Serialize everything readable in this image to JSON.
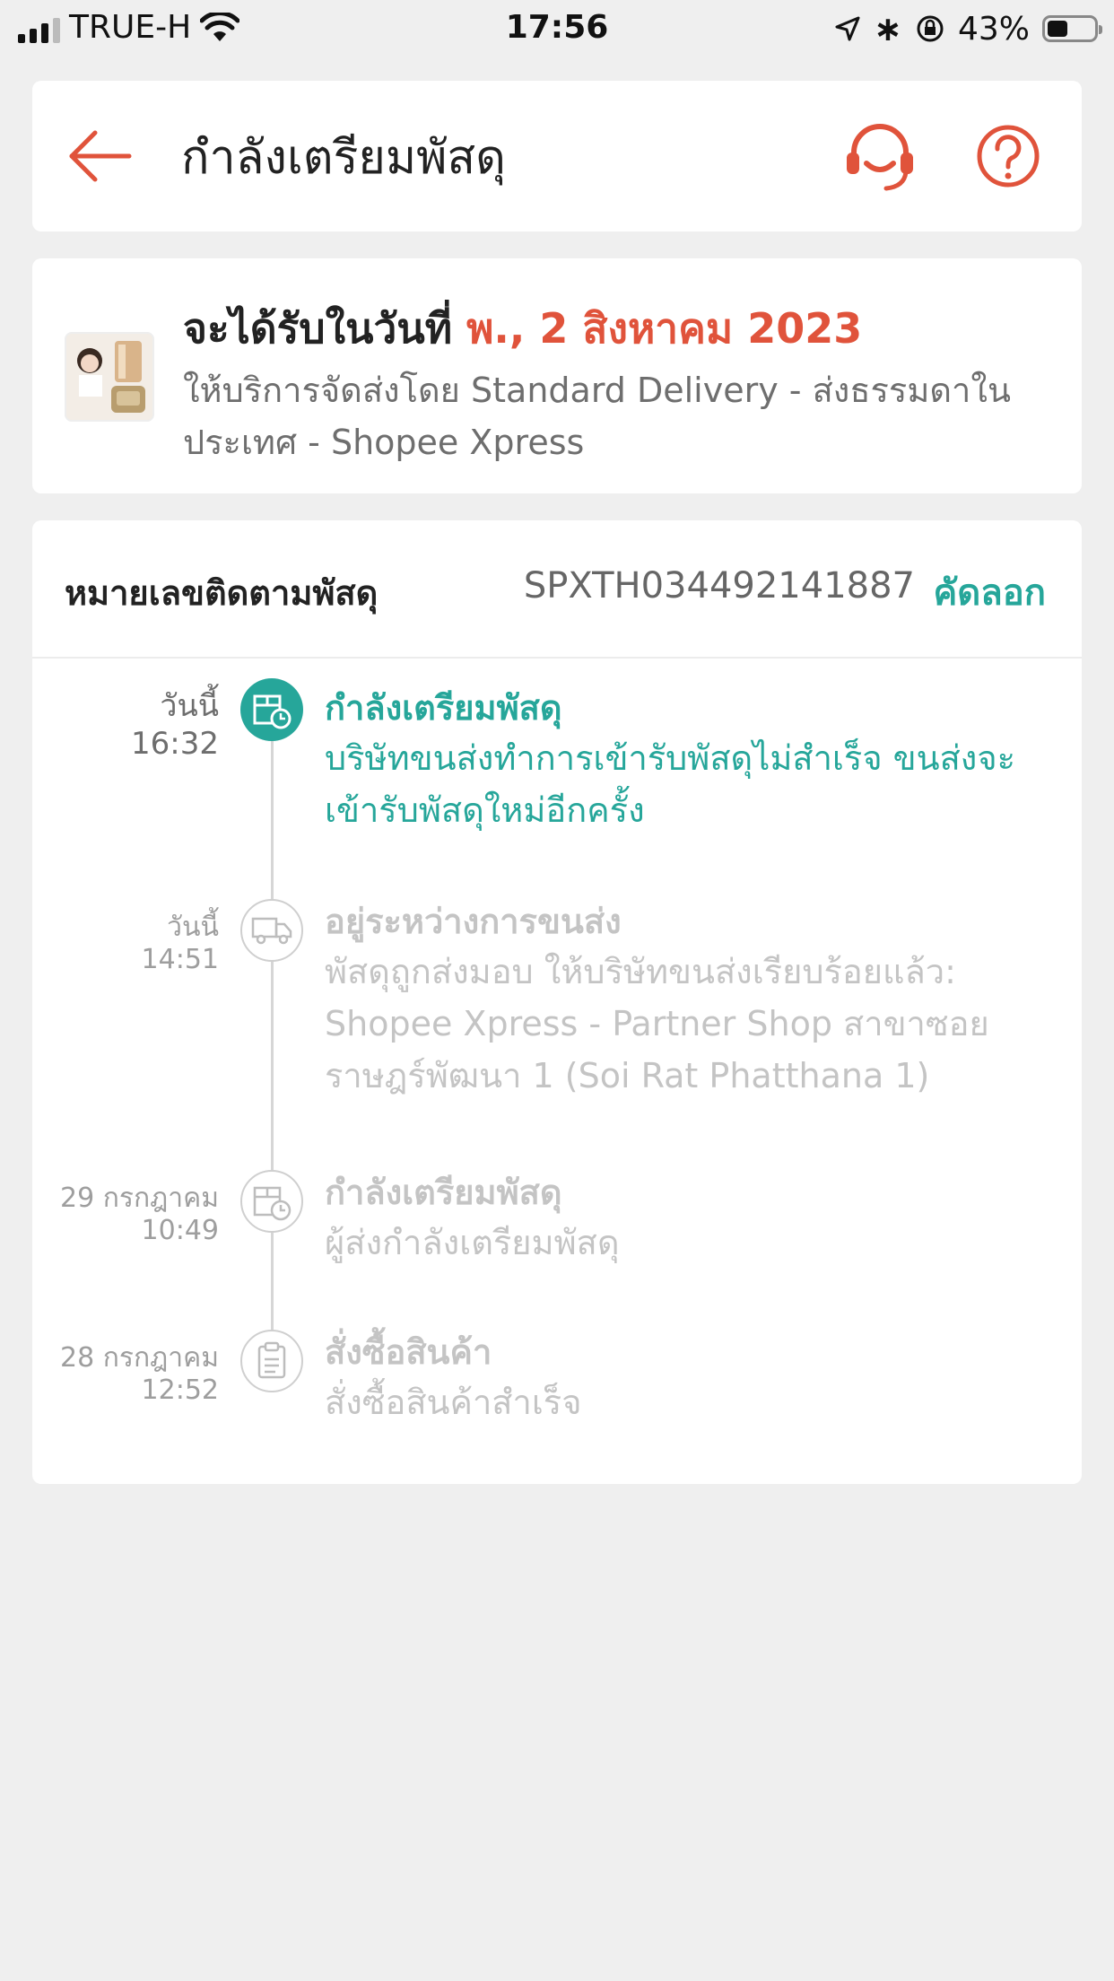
{
  "status_bar": {
    "carrier": "TRUE-H",
    "time": "17:56",
    "battery": "43%",
    "battery_level": 0.43
  },
  "header": {
    "title": "กำลังเตรียมพัสดุ",
    "back_icon": "arrow-left-icon",
    "support_icon": "headset-icon",
    "help_icon": "question-circle-icon",
    "accent_color": "#e0533b"
  },
  "delivery": {
    "prefix": "จะได้รับในวันที่ ",
    "date": "พ., 2 สิงหาคม 2023",
    "service": "ให้บริการจัดส่งโดย Standard Delivery - ส่งธรรมดาในประเทศ - Shopee Xpress"
  },
  "tracking": {
    "label": "หมายเลขติดตามพัสดุ",
    "number": "SPXTH034492141887",
    "copy_label": "คัดลอก"
  },
  "events": [
    {
      "date": "วันนี้",
      "time": "16:32",
      "title": "กำลังเตรียมพัสดุ",
      "description": "บริษัทขนส่งทำการเข้ารับพัสดุไม่สำเร็จ ขนส่งจะเข้ารับพัสดุใหม่อีกครั้ง",
      "icon": "package-clock-icon",
      "active": true
    },
    {
      "date": "วันนี้",
      "time": "14:51",
      "title": "อยู่ระหว่างการขนส่ง",
      "description": "พัสดุถูกส่งมอบ ให้บริษัทขนส่งเรียบร้อยแล้ว: Shopee Xpress - Partner Shop สาขาซอยราษฎร์พัฒนา 1 (Soi Rat Phatthana 1)",
      "icon": "truck-icon",
      "active": false
    },
    {
      "date": "29 กรกฎาคม",
      "time": "10:49",
      "title": "กำลังเตรียมพัสดุ",
      "description": " ผู้ส่งกำลังเตรียมพัสดุ",
      "icon": "package-clock-icon",
      "active": false
    },
    {
      "date": "28 กรกฎาคม",
      "time": "12:52",
      "title": "สั่งซื้อสินค้า",
      "description": "สั่งซื้อสินค้าสำเร็จ",
      "icon": "clipboard-icon",
      "active": false
    }
  ],
  "colors": {
    "green": "#26a69a",
    "orange": "#e0533b",
    "background": "#efefef"
  }
}
